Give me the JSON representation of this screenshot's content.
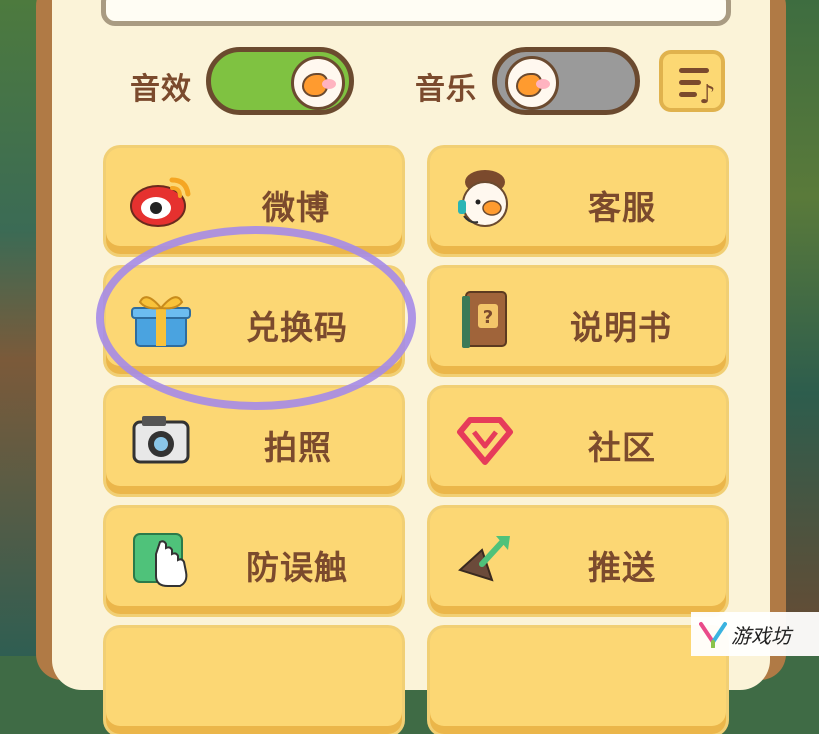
{
  "settings": {
    "sound_effects_label": "音效",
    "sound_effects_state": "on",
    "music_label": "音乐",
    "music_state": "off"
  },
  "menu": {
    "weibo": "微博",
    "customer_service": "客服",
    "redeem_code": "兑换码",
    "manual": "说明书",
    "photo": "拍照",
    "community": "社区",
    "anti_mistouch": "防误触",
    "push": "推送"
  },
  "watermark": {
    "text": "游戏坊"
  },
  "colors": {
    "button": "#fcd774",
    "text": "#7b4a2d",
    "toggle_on": "#7fc241",
    "toggle_off": "#9a9a9a",
    "highlight": "#a58be8"
  }
}
